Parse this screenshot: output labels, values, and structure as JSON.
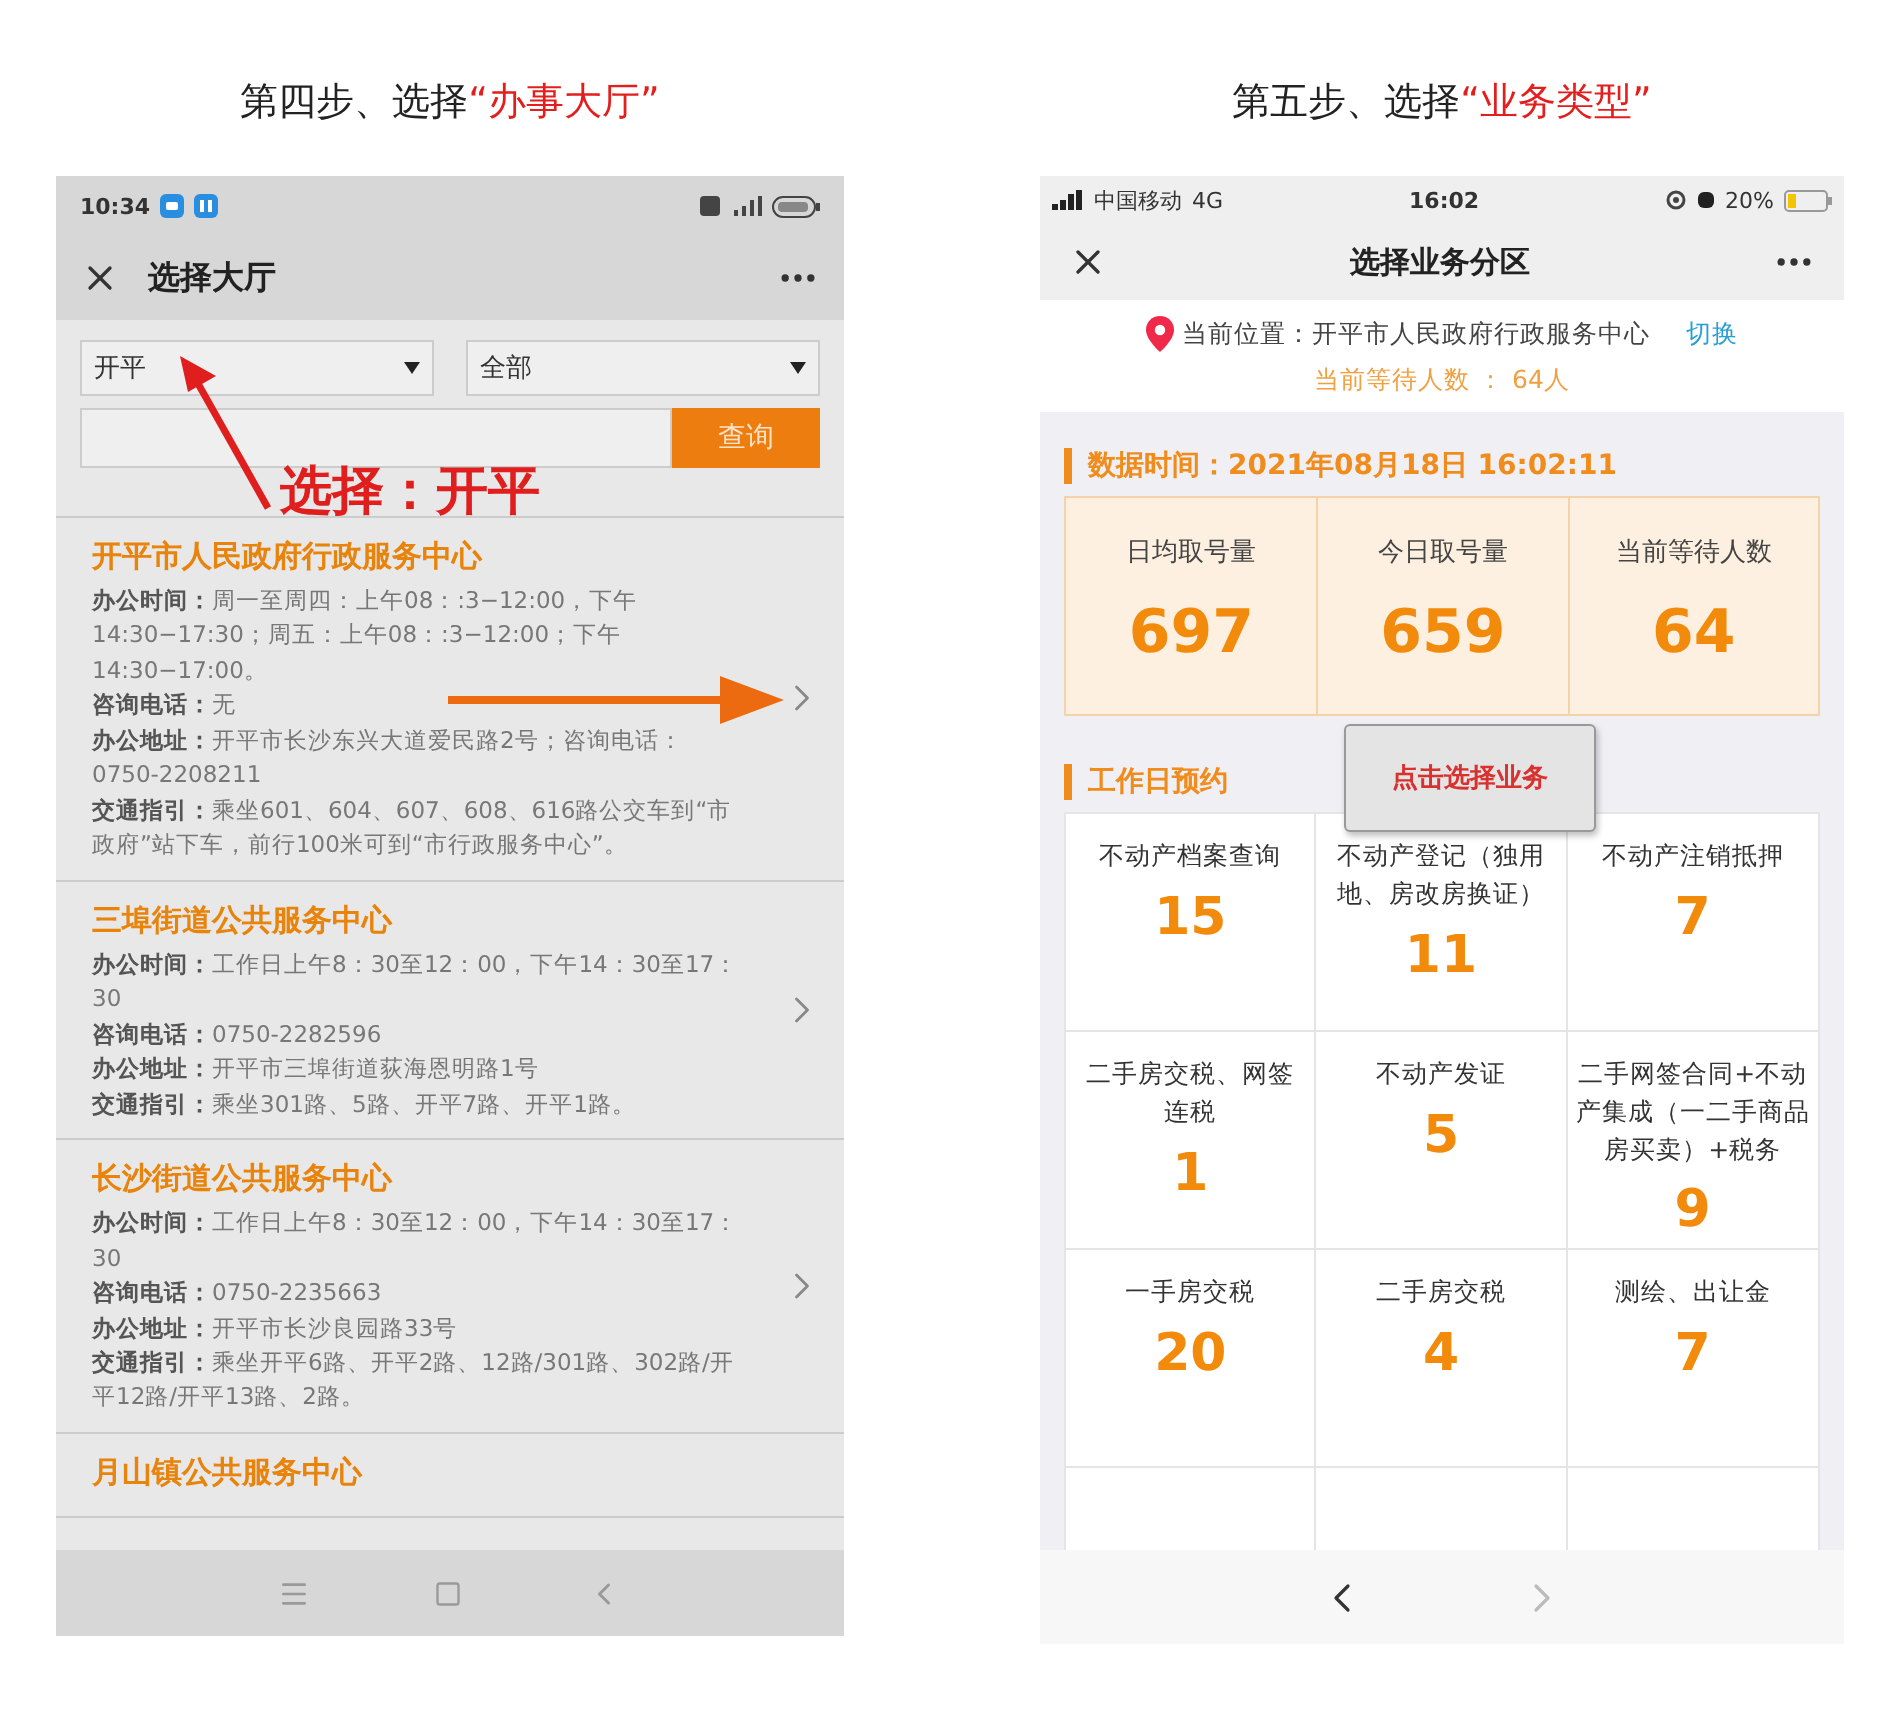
{
  "left_screen": {
    "caption": {
      "text": "第四步、选择",
      "highlight": "“办事大厅”"
    },
    "status_bar": {
      "time": "10:34"
    },
    "title": "选择大厅",
    "filters": {
      "city": "开平",
      "category": "全部",
      "search_button": "查询"
    },
    "annotation": "选择：开平",
    "halls": [
      {
        "name": "开平市人民政府行政服务中心",
        "lines": [
          {
            "label": "办公时间：",
            "value": "周一至周四：上午08：:3−12:00，下午14:30−17:30；周五：上午08：:3−12:00；下午14:30−17:00。"
          },
          {
            "label": "咨询电话：",
            "value": "无"
          },
          {
            "label": "办公地址：",
            "value": "开平市长沙东兴大道爱民路2号；咨询电话：0750-2208211"
          },
          {
            "label": "交通指引：",
            "value": "乘坐601、604、607、608、616路公交车到“市政府”站下车，前行100米可到“市行政服务中心”。"
          }
        ]
      },
      {
        "name": "三埠街道公共服务中心",
        "lines": [
          {
            "label": "办公时间：",
            "value": "工作日上午8：30至12：00，下午14：30至17：30"
          },
          {
            "label": "咨询电话：",
            "value": "0750-2282596"
          },
          {
            "label": "办公地址：",
            "value": "开平市三埠街道荻海恩明路1号"
          },
          {
            "label": "交通指引：",
            "value": "乘坐301路、5路、开平7路、开平1路。"
          }
        ]
      },
      {
        "name": "长沙街道公共服务中心",
        "lines": [
          {
            "label": "办公时间：",
            "value": "工作日上午8：30至12：00，下午14：30至17：30"
          },
          {
            "label": "咨询电话：",
            "value": "0750-2235663"
          },
          {
            "label": "办公地址：",
            "value": "开平市长沙良园路33号"
          },
          {
            "label": "交通指引：",
            "value": "乘坐开平6路、开平2路、12路/301路、302路/开平12路/开平13路、2路。"
          }
        ]
      },
      {
        "name": "月山镇公共服务中心"
      }
    ]
  },
  "right_screen": {
    "caption": {
      "text": "第五步、选择",
      "highlight": "“业务类型”"
    },
    "status_bar": {
      "carrier": "中国移动",
      "network": "4G",
      "time": "16:02",
      "battery": "20%"
    },
    "title": "选择业务分区",
    "location": {
      "text": "当前位置：开平市人民政府行政服务中心",
      "switch_link": "切换"
    },
    "waiting": "当前等待人数 ： 64人",
    "data_time": "数据时间：2021年08月18日 16:02:11",
    "stats": [
      {
        "label": "日均取号量",
        "value": "697"
      },
      {
        "label": "今日取号量",
        "value": "659"
      },
      {
        "label": "当前等待人数",
        "value": "64"
      }
    ],
    "tooltip": "点击选择业务",
    "section_title": "工作日预约",
    "services": [
      {
        "label": "不动产档案查询",
        "count": "15"
      },
      {
        "label": "不动产登记（独用地、房改房换证）",
        "count": "11"
      },
      {
        "label": "不动产注销抵押",
        "count": "7"
      },
      {
        "label": "二手房交税、网签连税",
        "count": "1"
      },
      {
        "label": "不动产发证",
        "count": "5"
      },
      {
        "label": "二手网签合同+不动产集成（一二手商品房买卖）+税务",
        "count": "9"
      },
      {
        "label": "一手房交税",
        "count": "20"
      },
      {
        "label": "二手房交税",
        "count": "4"
      },
      {
        "label": "测绘、出让金",
        "count": "7"
      }
    ],
    "nav_buttons": [
      {
        "kind": "back",
        "disabled": false
      },
      {
        "kind": "forward",
        "disabled": true
      }
    ]
  }
}
